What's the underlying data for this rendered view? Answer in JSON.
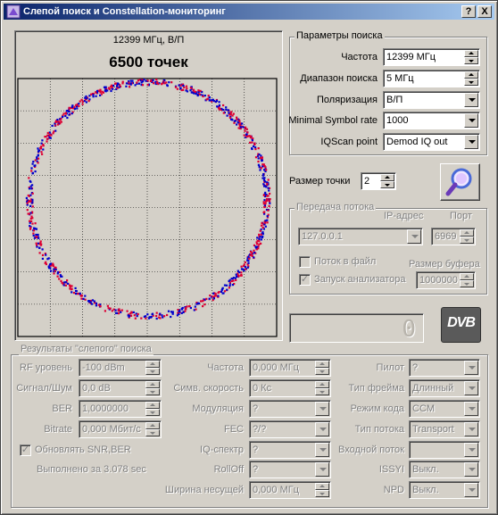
{
  "window": {
    "title": "Слепой поиск и Constellation-мониторинг",
    "help_btn": "?",
    "close_btn": "X"
  },
  "constellation": {
    "freq_label": "12399 МГц, В/П",
    "points_label": "6500 точек",
    "points": 6500,
    "dot_colors": [
      "#0000cc",
      "#dd0033"
    ]
  },
  "search_params": {
    "title": "Параметры поиска",
    "frequency": {
      "label": "Частота",
      "value": "12399 МГц"
    },
    "range": {
      "label": "Диапазон поиска",
      "value": "5 МГц"
    },
    "polarization": {
      "label": "Поляризация",
      "value": "В/П"
    },
    "min_symbol_rate": {
      "label": "Minimal Symbol rate",
      "value": "1000"
    },
    "iqscan_point": {
      "label": "IQScan point",
      "value": "Demod IQ out"
    }
  },
  "point_size": {
    "label": "Размер точки",
    "value": "2"
  },
  "scan_button": {
    "icon": "magnifier-icon"
  },
  "stream_transfer": {
    "title": "Передача потока",
    "ip_label": "IP-адрес",
    "ip_value": "127.0.0.1",
    "port_label": "Порт",
    "port_value": "6969",
    "stream_to_file": {
      "label": "Поток в файл",
      "checked": false
    },
    "launch_analyzer": {
      "label": "Запуск анализатора",
      "checked": true
    },
    "buffer_label": "Размер буфера",
    "buffer_value": "1000000"
  },
  "lcd_digit": "0",
  "dvb_logo": "DVB",
  "results": {
    "title": "Результаты \"слепого\" поиска",
    "rf_level": {
      "label": "RF уровень",
      "value": "-100 dBm"
    },
    "snr": {
      "label": "Сигнал/Шум",
      "value": "0,0 dB"
    },
    "ber": {
      "label": "BER",
      "value": "1,0000000"
    },
    "bitrate": {
      "label": "Bitrate",
      "value": "0,000 Мбит/с"
    },
    "update_snr": {
      "label": "Обновлять SNR,BER",
      "checked": true
    },
    "elapsed": "Выполнено за 3.078 sec",
    "frequency": {
      "label": "Частота",
      "value": "0,000 МГц"
    },
    "symbol_rate": {
      "label": "Симв. скорость",
      "value": "0 Кс"
    },
    "modulation": {
      "label": "Модуляция",
      "value": "?"
    },
    "fec": {
      "label": "FEC",
      "value": "?/?"
    },
    "iq_spectrum": {
      "label": "IQ-спектр",
      "value": "?"
    },
    "rolloff": {
      "label": "RollOff",
      "value": "?"
    },
    "carrier_width": {
      "label": "Ширина несущей",
      "value": "0,000 МГц"
    },
    "pilot": {
      "label": "Пилот",
      "value": "?"
    },
    "frame_type": {
      "label": "Тип фрейма",
      "value": "Длинный"
    },
    "code_mode": {
      "label": "Режим кода",
      "value": "CCM"
    },
    "stream_type": {
      "label": "Тип потока",
      "value": "Transport"
    },
    "input_stream": {
      "label": "Входной поток",
      "value": ""
    },
    "issyi": {
      "label": "ISSYI",
      "value": "Выкл."
    },
    "npd": {
      "label": "NPD",
      "value": "Выкл."
    }
  }
}
